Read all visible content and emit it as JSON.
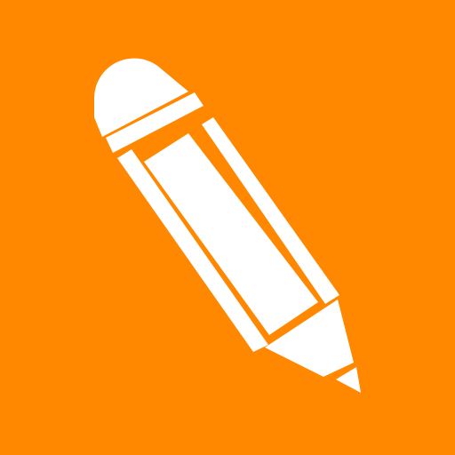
{
  "icon": {
    "name": "pencil-icon",
    "background_color": "#FF8800",
    "foreground_color": "#FFFFFF"
  }
}
